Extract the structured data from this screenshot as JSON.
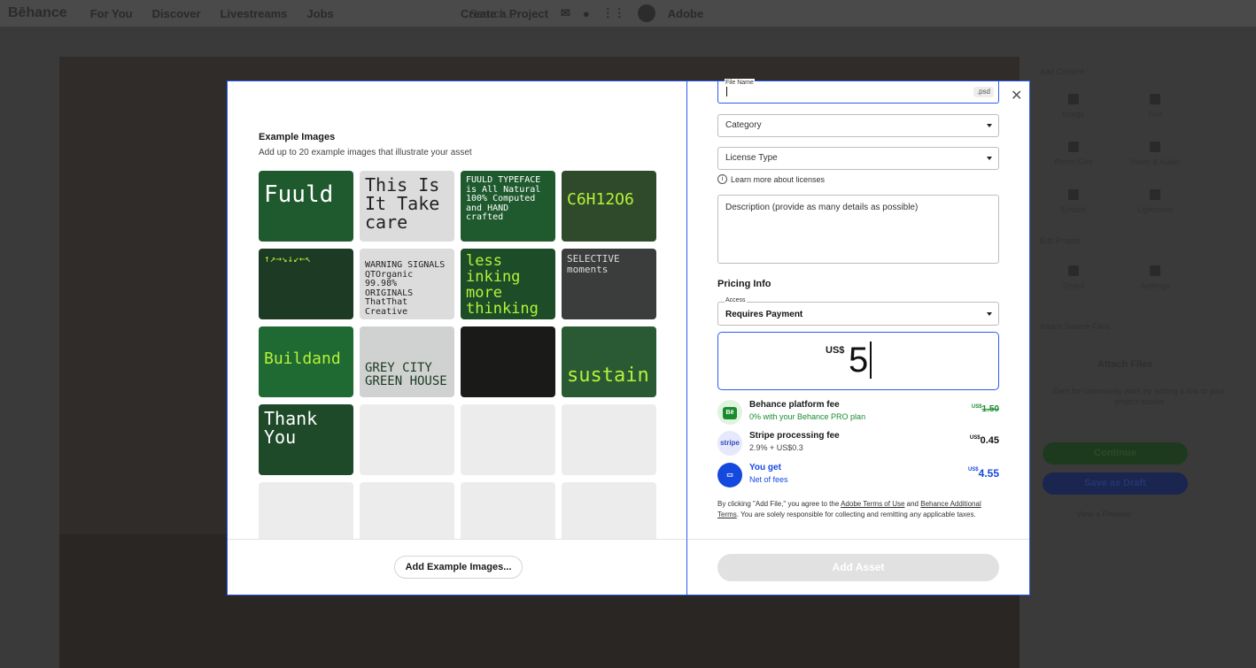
{
  "topbar": {
    "logo": "Bēhance",
    "nav": [
      "For You",
      "Discover",
      "Livestreams",
      "Jobs"
    ],
    "search_placeholder": "Search...",
    "create": "Create a Project",
    "adobe": "Adobe"
  },
  "side_panel": {
    "add_content": "Add Content",
    "tools": [
      "Image",
      "Text",
      "Photo Grid",
      "Video & Audio",
      "Embed",
      "Lightroom"
    ],
    "edit_project": "Edit Project",
    "edit_tools": [
      "Styles",
      "Settings"
    ],
    "attach_heading": "Attach Source Files",
    "attach_label": "Attach Files",
    "attach_help": "Earn for community work by adding a link to your project assets",
    "continue": "Continue",
    "save_draft": "Save as Draft",
    "preview": "View a Preview"
  },
  "modal": {
    "example_title": "Example Images",
    "example_sub": "Add up to 20 example images that illustrate your asset",
    "tiles": [
      {
        "text": "Fuuld"
      },
      {
        "text": "This Is It Take care"
      },
      {
        "text": "FUULD TYPEFACE is All Natural 100% Computed and HAND crafted"
      },
      {
        "text": "C6H12O6"
      },
      {
        "text": "↑↗→↘↓↙←↖"
      },
      {
        "text": "WARNING SIGNALS QTOrganic 99.98% ORIGINALS ThatThat Creative"
      },
      {
        "text": "less inking more thinking"
      },
      {
        "text": "SELECTIVE moments"
      },
      {
        "text": "Buildand"
      },
      {
        "text": "GREY CITY GREEN HOUSE"
      },
      {
        "text": ""
      },
      {
        "text": "sustain"
      },
      {
        "text": "Thank You"
      }
    ],
    "add_examples": "Add Example Images...",
    "file_name_label": "File Name",
    "file_name_value": "",
    "file_ext": ".psd",
    "category": "Category",
    "license_type": "License Type",
    "learn_licenses": "Learn more about licenses",
    "description": "Description (provide as many details as possible)",
    "pricing_info": "Pricing Info",
    "access_label": "Access",
    "access_value": "Requires Payment",
    "currency": "US$",
    "price": "5",
    "fees": [
      {
        "badge": "Bē",
        "name": "Behance platform fee",
        "desc": "0% with your Behance PRO plan",
        "cur": "US$",
        "value": "1.50"
      },
      {
        "badge": "stripe",
        "name": "Stripe processing fee",
        "desc": "2.9% + US$0.3",
        "cur": "US$",
        "value": "0.45"
      },
      {
        "badge": "▭",
        "name": "You get",
        "desc": "Net of fees",
        "cur": "US$",
        "value": "4.55"
      }
    ],
    "legal_pre": "By clicking \"Add File,\" you agree to the ",
    "legal_link1": "Adobe Terms of Use",
    "legal_mid": " and ",
    "legal_link2": "Behance Additional Terms",
    "legal_post": ". You are solely responsible for collecting and remitting any applicable taxes.",
    "add_asset": "Add Asset",
    "colors": {
      "accent": "#2a5df0",
      "green": "#1a8c2e",
      "blue": "#1449e0",
      "tile_green": "#1f5a2e",
      "lime": "#b6f23a"
    }
  }
}
